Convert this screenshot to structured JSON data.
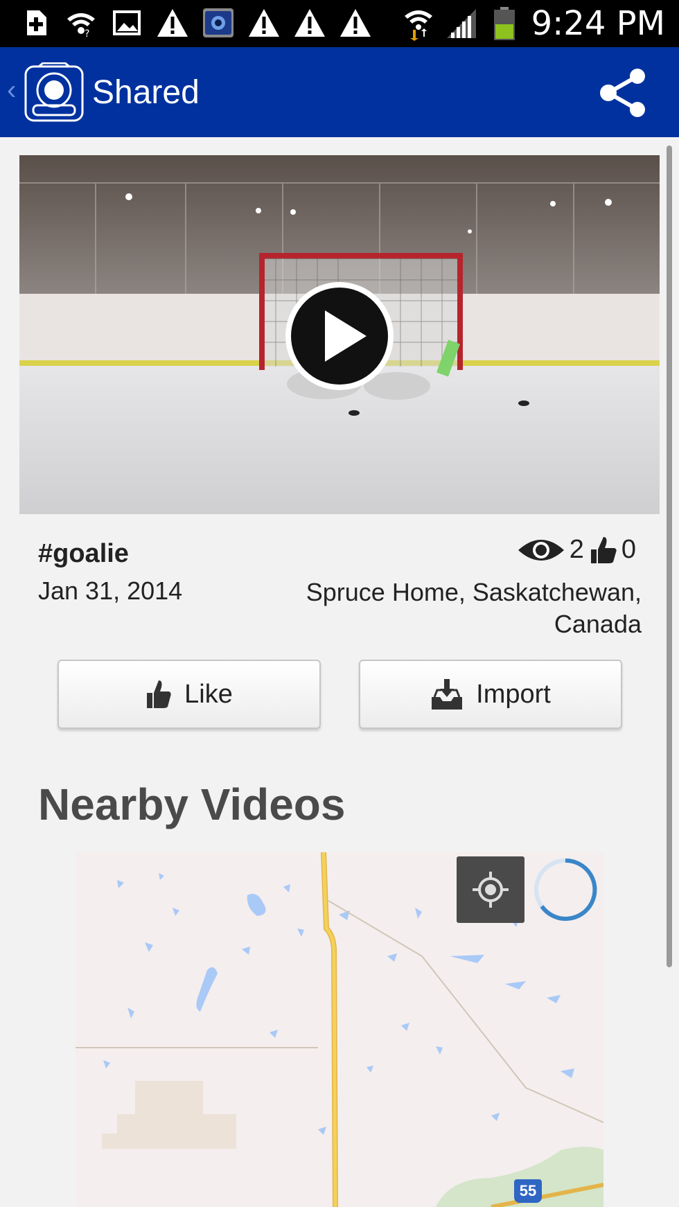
{
  "status_bar": {
    "time": "9:24 PM",
    "left_icons": [
      "add-icon",
      "wifi-icon",
      "image-icon",
      "warning-icon",
      "camera-app-icon",
      "warning-icon",
      "warning-icon",
      "warning-icon"
    ],
    "right_icons": [
      "wifi-upload-icon",
      "signal-icon",
      "battery-icon"
    ]
  },
  "action_bar": {
    "title": "Shared",
    "color": "#00319f"
  },
  "video": {
    "tag": "#goalie",
    "date": "Jan 31, 2014",
    "views": "2",
    "likes": "0",
    "location": "Spruce Home, Saskatchewan, Canada"
  },
  "buttons": {
    "like_label": "Like",
    "import_label": "Import"
  },
  "nearby": {
    "title": "Nearby Videos",
    "route_label": "55"
  }
}
